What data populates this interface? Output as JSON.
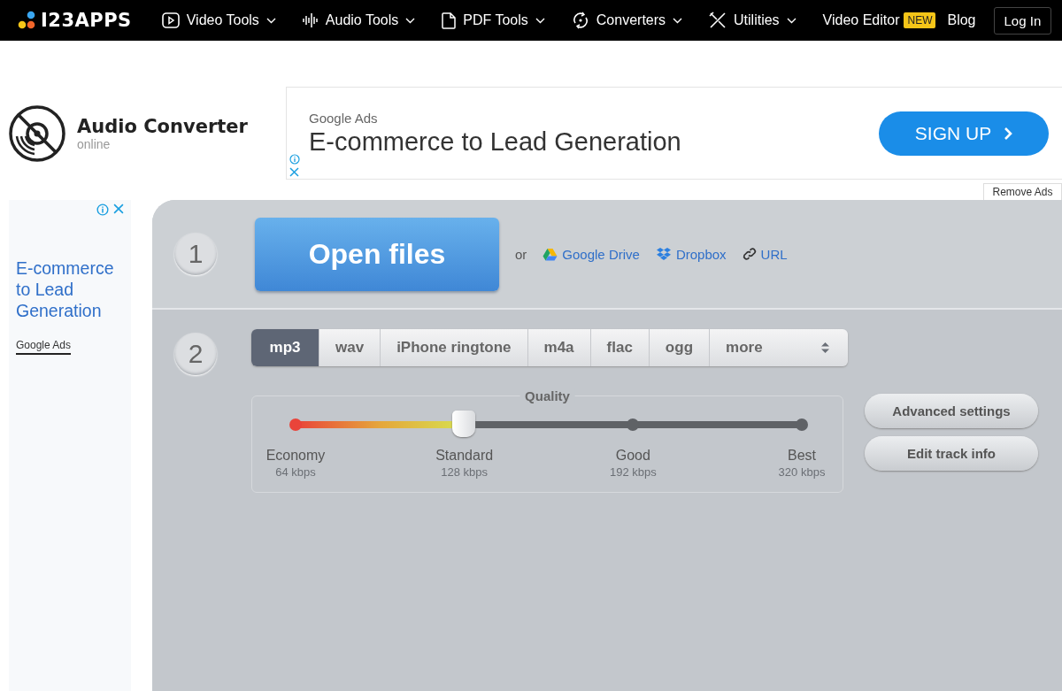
{
  "nav": {
    "logo": "I23APPS",
    "items": [
      {
        "kind": "video",
        "label": "Video Tools"
      },
      {
        "kind": "audio",
        "label": "Audio Tools"
      },
      {
        "kind": "pdf",
        "label": "PDF Tools"
      },
      {
        "kind": "convert",
        "label": "Converters"
      },
      {
        "kind": "tools",
        "label": "Utilities"
      }
    ],
    "video_editor": "Video Editor",
    "new_badge": "NEW",
    "blog": "Blog",
    "login": "Log In"
  },
  "app": {
    "title": "Audio Converter",
    "subtitle": "online"
  },
  "top_ad": {
    "label": "Google Ads",
    "headline": "E-commerce to Lead Generation",
    "cta": "SIGN UP"
  },
  "remove_ads": "Remove Ads",
  "side_ad": {
    "headline": "E-commerce to Lead Generation",
    "label": "Google Ads"
  },
  "step1": {
    "number": "1",
    "open_button": "Open files",
    "or": "or",
    "sources": [
      {
        "kind": "drive",
        "label": "Google Drive"
      },
      {
        "kind": "dropbox",
        "label": "Dropbox"
      },
      {
        "kind": "url",
        "label": "URL"
      }
    ]
  },
  "step2": {
    "number": "2",
    "formats": [
      {
        "label": "mp3",
        "selected": true
      },
      {
        "label": "wav",
        "selected": false
      },
      {
        "label": "iPhone ringtone",
        "selected": false
      },
      {
        "label": "m4a",
        "selected": false
      },
      {
        "label": "flac",
        "selected": false
      },
      {
        "label": "ogg",
        "selected": false
      }
    ],
    "more": "more",
    "quality": {
      "title": "Quality",
      "level": 0.333,
      "stops": [
        {
          "name": "Economy",
          "rate": "64 kbps"
        },
        {
          "name": "Standard",
          "rate": "128 kbps"
        },
        {
          "name": "Good",
          "rate": "192 kbps"
        },
        {
          "name": "Best",
          "rate": "320 kbps"
        }
      ]
    },
    "buttons": [
      "Advanced settings",
      "Edit track info"
    ]
  }
}
